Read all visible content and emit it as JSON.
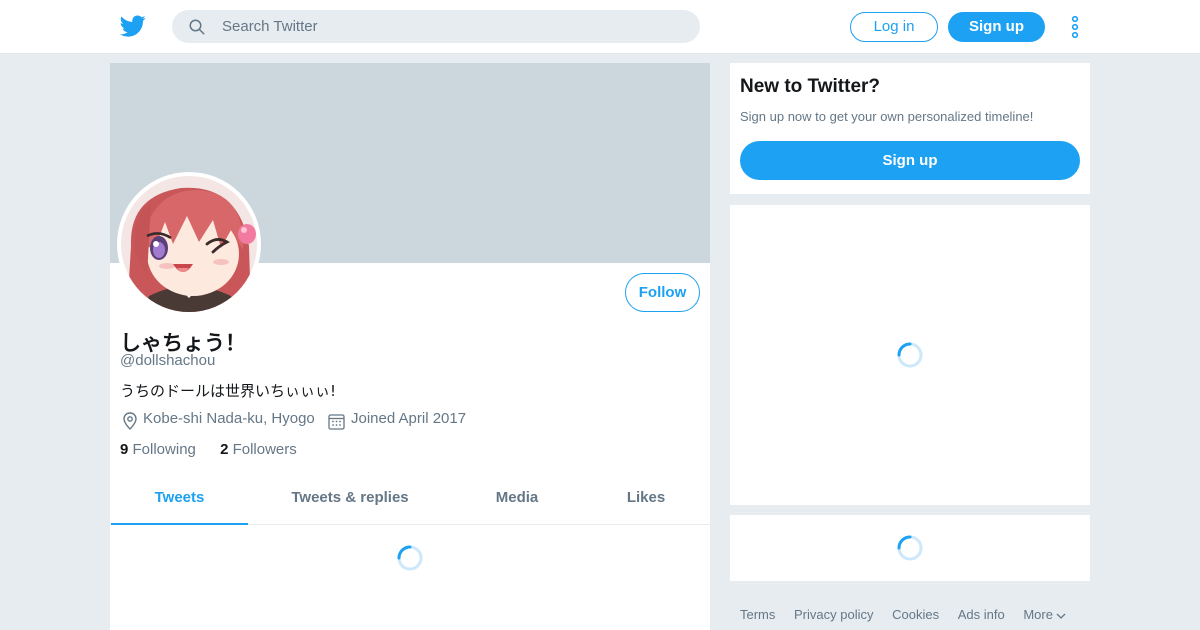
{
  "header": {
    "search_placeholder": "Search Twitter",
    "login_label": "Log in",
    "signup_label": "Sign up",
    "logo_icon": "twitter-bird-icon",
    "search_icon": "search-icon",
    "more_icon": "vertical-dots-icon"
  },
  "profile": {
    "display_name": "しゃちょう！",
    "handle": "@dollshachou",
    "bio": "うちのドールは世界いちぃぃぃ!",
    "location": "Kobe-shi Nada-ku, Hyogo",
    "joined": "Joined April 2017",
    "follow_label": "Follow",
    "stats": {
      "following_count": "9",
      "following_label": "Following",
      "followers_count": "2",
      "followers_label": "Followers"
    }
  },
  "tabs": [
    {
      "label": "Tweets",
      "active": true
    },
    {
      "label": "Tweets & replies",
      "active": false
    },
    {
      "label": "Media",
      "active": false
    },
    {
      "label": "Likes",
      "active": false
    }
  ],
  "sidebar": {
    "signup_title": "New to Twitter?",
    "signup_subtitle": "Sign up now to get your own personalized timeline!",
    "signup_button": "Sign up"
  },
  "footer": {
    "links": [
      "Terms",
      "Privacy policy",
      "Cookies",
      "Ads info",
      "More"
    ]
  },
  "colors": {
    "accent": "#1da1f2",
    "background": "#e6ecf0",
    "banner": "#ccd6dd",
    "muted_text": "#657786"
  }
}
